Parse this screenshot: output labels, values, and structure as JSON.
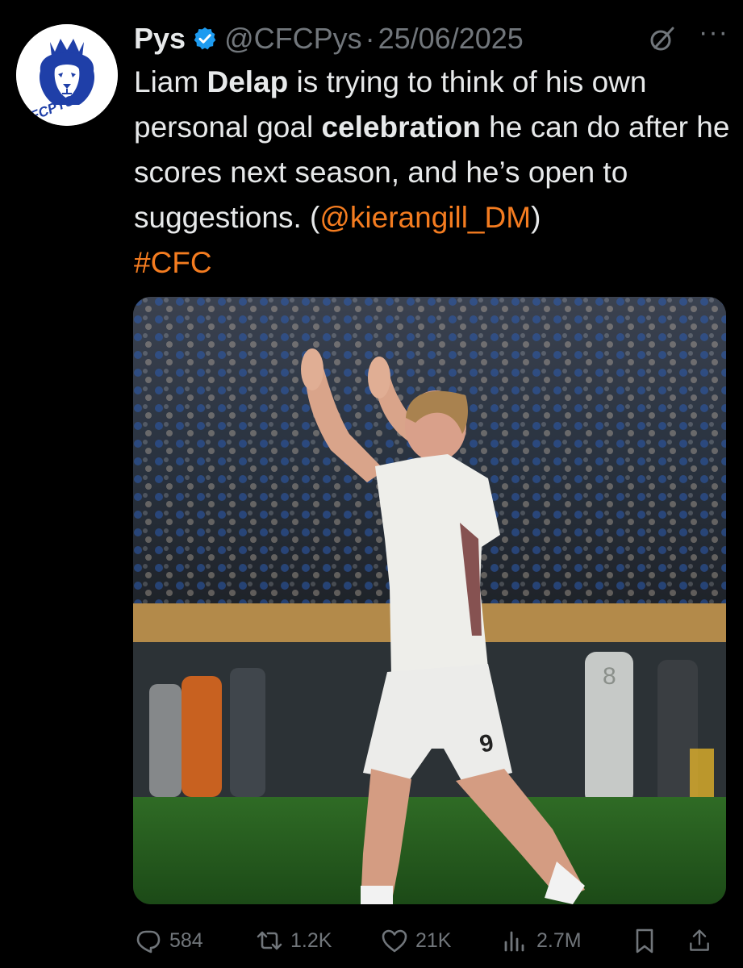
{
  "tweet": {
    "avatar_text": "CFCPYS",
    "author_name": "Pys",
    "handle": "@CFCPys",
    "separator": "·",
    "date": "25/06/2025",
    "text_parts": {
      "p1": "Liam ",
      "p2": "Delap",
      "p3": " is trying to think of his own personal goal ",
      "p4": "celebration",
      "p5": " he can do after he scores next season, and he’s open to suggestions. (",
      "mention": "@kierangill_DM",
      "p6": ")",
      "hashtag": "#CFC"
    },
    "media": {
      "jersey_number": "9",
      "background_player_number": "8"
    }
  },
  "actions": {
    "replies": "584",
    "reposts": "1.2K",
    "likes": "21K",
    "views": "2.7M"
  },
  "colors": {
    "background": "#000000",
    "text": "#e7e9ea",
    "secondary": "#71767b",
    "link": "#f47c20",
    "verified": "#1d9bf0",
    "avatar_blue": "#1f3fa8"
  }
}
